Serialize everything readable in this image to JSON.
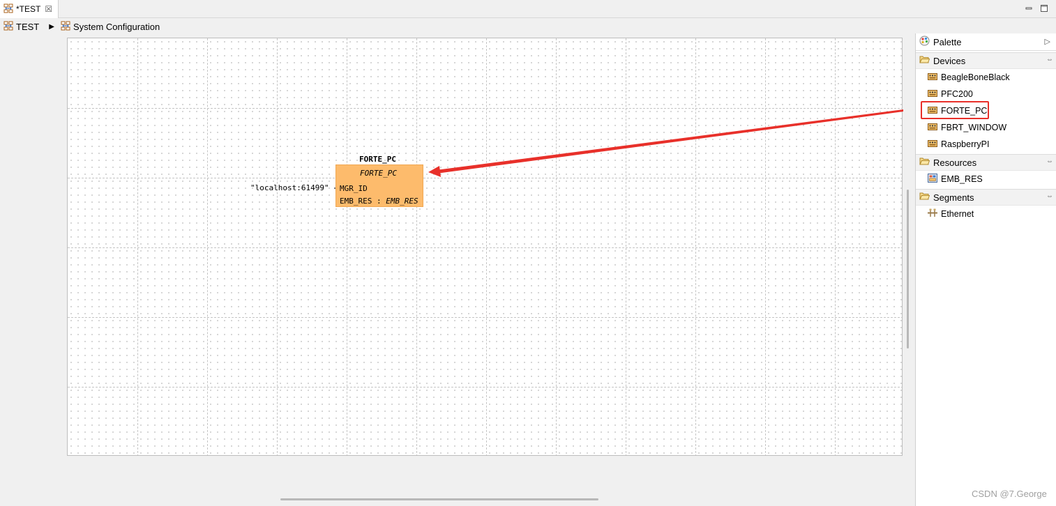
{
  "editor_tab": {
    "title": "*TEST",
    "close_glyph": "☒",
    "icon": "system-config-icon"
  },
  "window_controls": {
    "minimize_glyph": "─",
    "maximize_glyph": "□"
  },
  "breadcrumb": {
    "items": [
      {
        "label": "TEST",
        "icon": "system-config-icon"
      },
      {
        "label": "System Configuration",
        "icon": "system-config-icon"
      }
    ],
    "separator": "▶"
  },
  "device": {
    "instance_name": "FORTE_PC",
    "type_name": "FORTE_PC",
    "parameter": {
      "name": "MGR_ID",
      "value": "\"localhost:61499\""
    },
    "resource": {
      "name": "EMB_RES",
      "separator": " : ",
      "type": "EMB_RES"
    }
  },
  "palette": {
    "title": "Palette",
    "collapse_glyph": "▷",
    "pin_glyph": "⇔",
    "drawers": [
      {
        "label": "Devices",
        "items": [
          {
            "label": "BeagleBoneBlack",
            "icon": "device-icon"
          },
          {
            "label": "PFC200",
            "icon": "device-icon"
          },
          {
            "label": "FORTE_PC",
            "icon": "device-icon",
            "highlighted": true
          },
          {
            "label": "FBRT_WINDOW",
            "icon": "device-icon"
          },
          {
            "label": "RaspberryPI",
            "icon": "device-icon"
          }
        ]
      },
      {
        "label": "Resources",
        "items": [
          {
            "label": "EMB_RES",
            "icon": "resource-icon"
          }
        ]
      },
      {
        "label": "Segments",
        "items": [
          {
            "label": "Ethernet",
            "icon": "segment-icon"
          }
        ]
      }
    ]
  },
  "annotation": {
    "color": "#e8302a"
  },
  "colors": {
    "device_fill": "#fdbb6c",
    "highlight": "#e8302a"
  },
  "watermark": "CSDN @7.George"
}
